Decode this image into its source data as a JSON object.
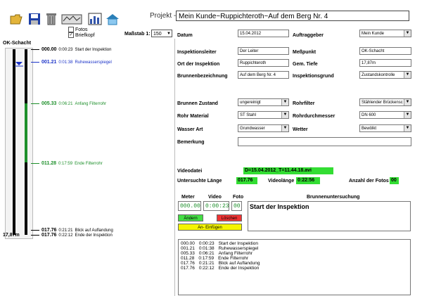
{
  "toolbar": {
    "buttons": [
      {
        "name": "open-folder-icon",
        "color": "#d9a21b"
      },
      {
        "name": "save-disk-icon",
        "color": "#1d3fa6"
      },
      {
        "name": "trash-icon",
        "color": "#888888"
      },
      {
        "name": "scan-device-icon",
        "color": "#666666"
      },
      {
        "name": "chart-report-icon",
        "color": "#3355aa"
      },
      {
        "name": "house-network-icon",
        "color": "#2a7fb8"
      }
    ],
    "project_label": "Projekt -",
    "project_value": "Mein Kunde~Ruppichteroth~Auf dem Berg Nr. 4",
    "fotos_label": "Fotos",
    "fotos_checked": false,
    "briefkopf_label": "Briefkopf",
    "briefkopf_checked": true,
    "massstab_label": "Maßstab 1:",
    "massstab_value": "150"
  },
  "profile": {
    "top_label": "OK-Schacht",
    "bottom_depth": "17,87m",
    "markers": [
      {
        "meter": "000.00",
        "time": "0:00:23",
        "text": "Start der Inspektion",
        "color": "#000000"
      },
      {
        "meter": "001.21",
        "time": "0:01:38",
        "text": "Ruhewasserspiegel",
        "color": "#1a32c8"
      },
      {
        "meter": "005.33",
        "time": "0:06:21",
        "text": "Anfang Filterrohr",
        "color": "#1d8f2a"
      },
      {
        "meter": "011.28",
        "time": "0:17:59",
        "text": "Ende Filterrohr",
        "color": "#1d8f2a"
      },
      {
        "meter": "017.76",
        "time": "0:21:21",
        "text": "Blick auf Auflandung",
        "color": "#000000"
      },
      {
        "meter": "017.76",
        "time": "0:22:12",
        "text": "Ende der Inspektion",
        "color": "#000000"
      }
    ]
  },
  "form": {
    "datum_label": "Datum",
    "datum": "15.04.2012",
    "auftraggeber_label": "Auftraggeber",
    "auftraggeber": "Mein Kunde",
    "inspektionsleiter_label": "Inspektionsleiter",
    "inspektionsleiter": "Der Leiter",
    "messpunkt_label": "Meßpunkt",
    "messpunkt": "OK-Schacht",
    "ort_label": "Ort der Inspektion",
    "ort": "Ruppichteroth",
    "tiefe_label": "Gem. Tiefe",
    "tiefe": "17,87m",
    "brunnenbez_label": "Brunnenbezeichnung",
    "brunnenbez": "Auf dem Berg Nr. 4",
    "inspektionsgrund_label": "Inspektionsgrund",
    "inspektionsgrund": "Zustandskontrolle",
    "zustand_label": "Brunnen Zustand",
    "zustand": "ungereinigt",
    "rohrfilter_label": "Rohrfilter",
    "rohrfilter": "Stählender Brückensc",
    "material_label": "Rohr Material",
    "material": "ST Stahl",
    "durchmesser_label": "Rohrdurchmesser",
    "durchmesser": "DN 600",
    "wasserart_label": "Wasser Art",
    "wasserart": "Grundwasser",
    "wetter_label": "Wetter",
    "wetter": "Bewölkt",
    "bemerkung_label": "Bemerkung",
    "bemerkung": ""
  },
  "video": {
    "datei_label": "Videodatei",
    "datei": "D=15.04.2012_T=11.44.18.avi",
    "laenge_label": "Untersuchte Länge",
    "laenge": "017.76",
    "videolaenge_label": "Videolänge",
    "videolaenge": "0:22:56",
    "fotos_label": "Anzahl der Fotos",
    "fotos": "00"
  },
  "entry": {
    "meter_header": "Meter",
    "video_header": "Video",
    "foto_header": "Foto",
    "brunnen_header": "Brunnenuntersuchung",
    "meter_value": "000.00",
    "video_value": "0:00:23",
    "foto_value": "00",
    "text_value": "Start der Inspektion",
    "aendern_label": "Ändern",
    "loeschen_label": "Löschen",
    "einfuegen_label": "An- Einfügen"
  },
  "log": [
    {
      "meter": "000.00",
      "time": "0:00:23",
      "text": "Start der Inspektion"
    },
    {
      "meter": "001.21",
      "time": "0:01:38",
      "text": "Ruhewasserspiegel"
    },
    {
      "meter": "005.33",
      "time": "0:06:21",
      "text": "Anfang Filterrohr"
    },
    {
      "meter": "011.28",
      "time": "0:17:59",
      "text": "Ende Filterrohr"
    },
    {
      "meter": "017.76",
      "time": "0:21:21",
      "text": "Blick auf Auflandung"
    },
    {
      "meter": "017.76",
      "time": "0:22:12",
      "text": "Ende der Inspektion"
    }
  ]
}
